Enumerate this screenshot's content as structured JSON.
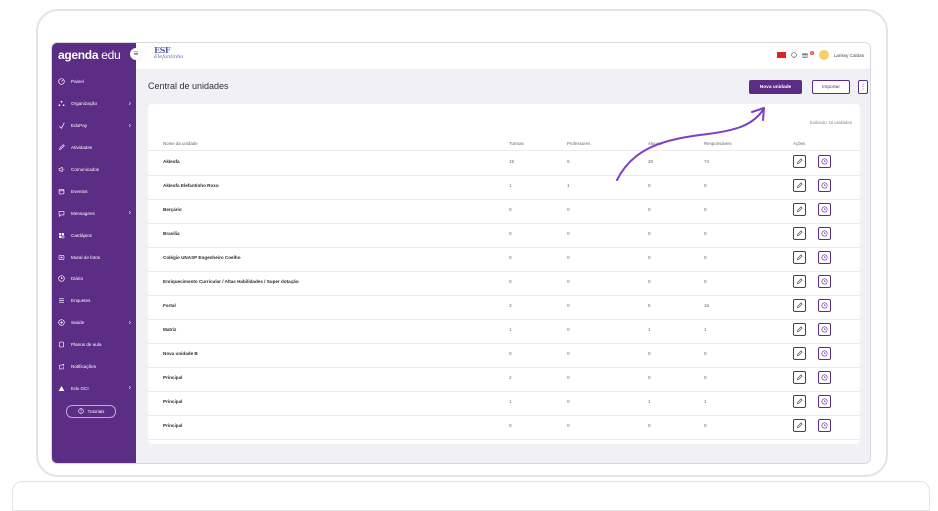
{
  "sidebar": {
    "brand_bold": "agenda",
    "brand_light": "edu",
    "collapse_symbol": "≡",
    "items": [
      {
        "label": "Painel",
        "icon": "dashboard-icon",
        "has_arrow": false
      },
      {
        "label": "Organização",
        "icon": "organization-icon",
        "has_arrow": true
      },
      {
        "label": "EduPay",
        "icon": "edupay-icon",
        "has_arrow": true
      },
      {
        "label": "Atividades",
        "icon": "pencil-icon",
        "has_arrow": false
      },
      {
        "label": "Comunicados",
        "icon": "megaphone-icon",
        "has_arrow": false
      },
      {
        "label": "Eventos",
        "icon": "calendar-icon",
        "has_arrow": false
      },
      {
        "label": "Mensagens",
        "icon": "chat-icon",
        "has_arrow": true
      },
      {
        "label": "Cardápios",
        "icon": "menu-card-icon",
        "has_arrow": false
      },
      {
        "label": "Mural de fotos",
        "icon": "photo-icon",
        "has_arrow": false
      },
      {
        "label": "Diário",
        "icon": "clock-icon",
        "has_arrow": false
      },
      {
        "label": "Enquetes",
        "icon": "list-icon",
        "has_arrow": false
      },
      {
        "label": "Saúde",
        "icon": "health-icon",
        "has_arrow": true
      },
      {
        "label": "Planos de aula",
        "icon": "lesson-plan-icon",
        "has_arrow": false
      },
      {
        "label": "Notificações",
        "icon": "notification-icon",
        "has_arrow": false
      },
      {
        "label": "Edu GCI",
        "icon": "triangle-icon",
        "has_arrow": true
      }
    ],
    "arrow_symbol": "›",
    "tutorials_label": "Tutoriais"
  },
  "topbar": {
    "school_mark": "ESF",
    "school_name": "Elefantinho",
    "user_name": "Larissy Caldas",
    "notification_count": "1"
  },
  "page": {
    "title": "Central de unidades",
    "new_unit_button": "Nova unidade",
    "import_button": "Importar",
    "more_button": "⋮",
    "showing_text": "Exibindo 18 unidades"
  },
  "table": {
    "headers": {
      "name": "Nome da unidade",
      "classes": "Turmas",
      "teachers": "Professores",
      "students": "Alunos",
      "guardians": "Responsáveis",
      "actions": "Ações"
    },
    "rows": [
      {
        "name": "Akleofa",
        "classes": "15",
        "teachers": "6",
        "students": "20",
        "guardians": "74"
      },
      {
        "name": "Akleofa Elefantinho Roxo",
        "classes": "1",
        "teachers": "1",
        "students": "0",
        "guardians": "0"
      },
      {
        "name": "Berçário",
        "classes": "0",
        "teachers": "0",
        "students": "0",
        "guardians": "0"
      },
      {
        "name": "Brasília",
        "classes": "0",
        "teachers": "0",
        "students": "0",
        "guardians": "0"
      },
      {
        "name": "Colégio UNASP Engenheiro Coelho",
        "classes": "0",
        "teachers": "0",
        "students": "0",
        "guardians": "0"
      },
      {
        "name": "Enriquecimento Curricular / Altas Habilidades / Super dotação",
        "classes": "0",
        "teachers": "0",
        "students": "0",
        "guardians": "0"
      },
      {
        "name": "Fortal",
        "classes": "3",
        "teachers": "0",
        "students": "5",
        "guardians": "16"
      },
      {
        "name": "Matriz",
        "classes": "1",
        "teachers": "0",
        "students": "1",
        "guardians": "1"
      },
      {
        "name": "Nova unidade B",
        "classes": "0",
        "teachers": "0",
        "students": "0",
        "guardians": "0"
      },
      {
        "name": "Principal",
        "classes": "2",
        "teachers": "0",
        "students": "0",
        "guardians": "0"
      },
      {
        "name": "Principal",
        "classes": "1",
        "teachers": "0",
        "students": "1",
        "guardians": "1"
      },
      {
        "name": "Principal",
        "classes": "0",
        "teachers": "0",
        "students": "0",
        "guardians": "0"
      }
    ]
  },
  "colors": {
    "brand_purple": "#5b2d84",
    "annotation_arrow": "#7a3fc6"
  }
}
